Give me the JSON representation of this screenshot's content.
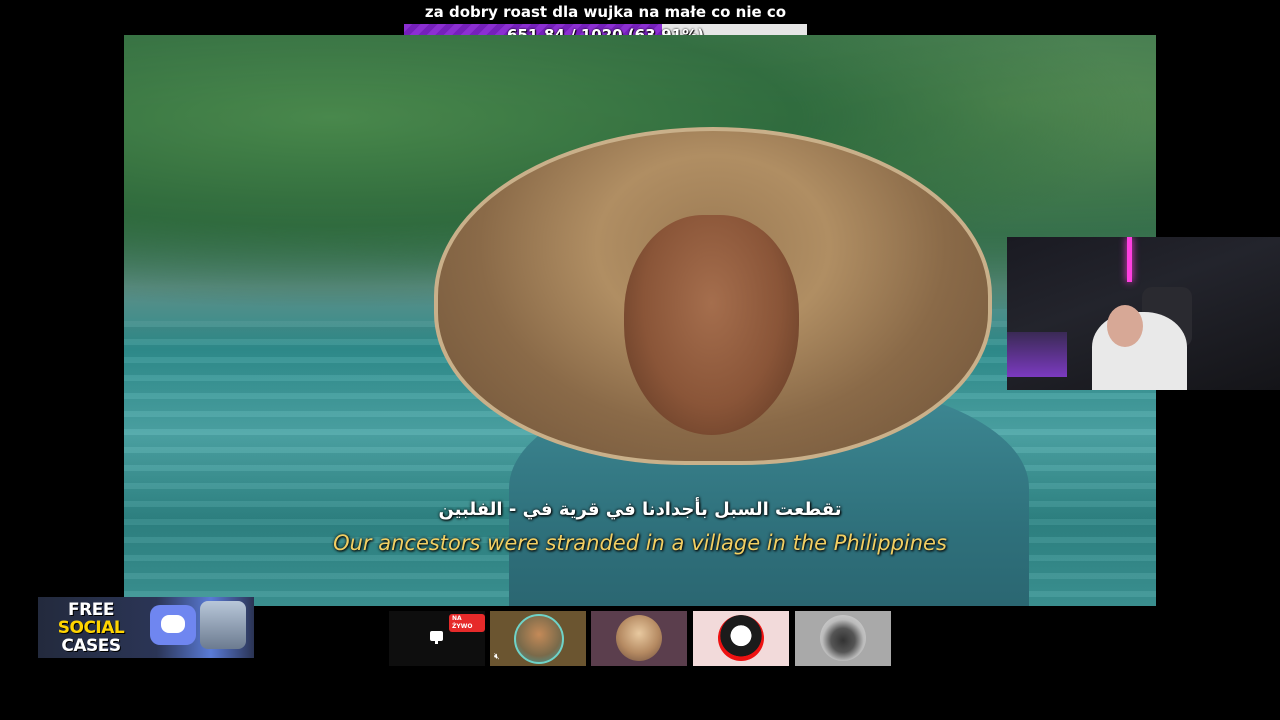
{
  "goal": {
    "title": "za dobry roast dla wujka na małe co nie co",
    "progress_text": "651.84 / 1020 (63.91%)",
    "current": 651.84,
    "target": 1020,
    "percent": 63.91,
    "fill_color": "#8b2fd1"
  },
  "subtitles": {
    "arabic": "تقطعت السبل بأجدادنا في قرية في - الفلبين",
    "english": "Our ancestors were stranded in a village in the Philippines"
  },
  "promo": {
    "line1": "FREE",
    "line2": "SOCIAL",
    "line3": "CASES"
  },
  "participants": [
    {
      "type": "screen-share",
      "icon": "monitor-icon",
      "badge": "NA ŻYWO"
    },
    {
      "type": "avatar",
      "muted": true,
      "icon": "mute-icon"
    },
    {
      "type": "avatar"
    },
    {
      "type": "avatar",
      "active": true
    },
    {
      "type": "avatar"
    }
  ],
  "colors": {
    "subtitle_en": "#f2cf63",
    "live_badge": "#e62a2a",
    "active_tile": "#f2dada"
  }
}
